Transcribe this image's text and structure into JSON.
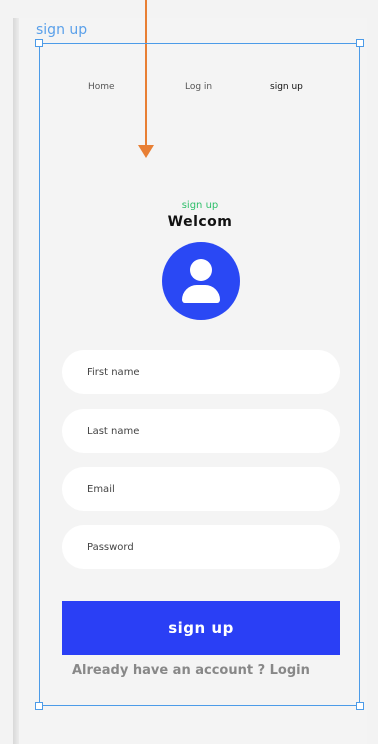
{
  "frame": {
    "label": "sign up"
  },
  "nav": {
    "home": "Home",
    "login": "Log in",
    "signup": "sign up"
  },
  "header": {
    "subtitle": "sign up",
    "title": "Welcom"
  },
  "form": {
    "first_name_placeholder": "First name",
    "last_name_placeholder": "Last name",
    "email_placeholder": "Email",
    "password_placeholder": "Password",
    "submit_label": "sign up"
  },
  "footer": {
    "already_text": "Already have an account ? Login"
  },
  "colors": {
    "accent_blue": "#2a3ff5",
    "avatar_blue": "#2a48f4",
    "subtitle_green": "#2ebf6a",
    "selection_blue": "#4c9be8",
    "arrow_orange": "#e87f34"
  },
  "icons": {
    "avatar": "user-avatar-icon",
    "arrow": "prototype-arrow"
  }
}
